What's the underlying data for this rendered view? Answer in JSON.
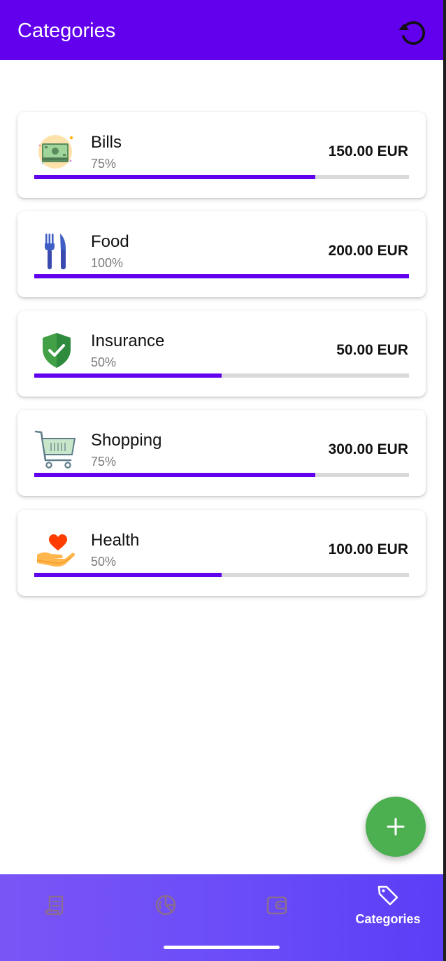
{
  "app_bar": {
    "title": "Categories",
    "reset_icon": "reset-icon"
  },
  "categories": [
    {
      "name": "Bills",
      "percent_label": "75%",
      "amount": "150.00 EUR",
      "progress": 0.75,
      "icon": "money-stack-icon"
    },
    {
      "name": "Food",
      "percent_label": "100%",
      "amount": "200.00 EUR",
      "progress": 1.0,
      "icon": "fork-knife-icon"
    },
    {
      "name": "Insurance",
      "percent_label": "50%",
      "amount": "50.00 EUR",
      "progress": 0.5,
      "icon": "shield-check-icon"
    },
    {
      "name": "Shopping",
      "percent_label": "75%",
      "amount": "300.00 EUR",
      "progress": 0.75,
      "icon": "shopping-cart-icon"
    },
    {
      "name": "Health",
      "percent_label": "50%",
      "amount": "100.00 EUR",
      "progress": 0.5,
      "icon": "heart-hand-icon"
    }
  ],
  "fab": {
    "icon": "plus-icon"
  },
  "bottom_nav": {
    "items": [
      {
        "icon": "receipt-icon",
        "label": ""
      },
      {
        "icon": "pie-chart-icon",
        "label": ""
      },
      {
        "icon": "wallet-icon",
        "label": ""
      },
      {
        "icon": "tag-icon",
        "label": "Categories"
      }
    ],
    "active_index": 3
  },
  "colors": {
    "primary": "#6200ee",
    "progress_track": "#d9d9d9",
    "fab": "#4caf50",
    "nav_inactive_icon": "#8a6d8f",
    "nav_active": "#ffffff"
  }
}
